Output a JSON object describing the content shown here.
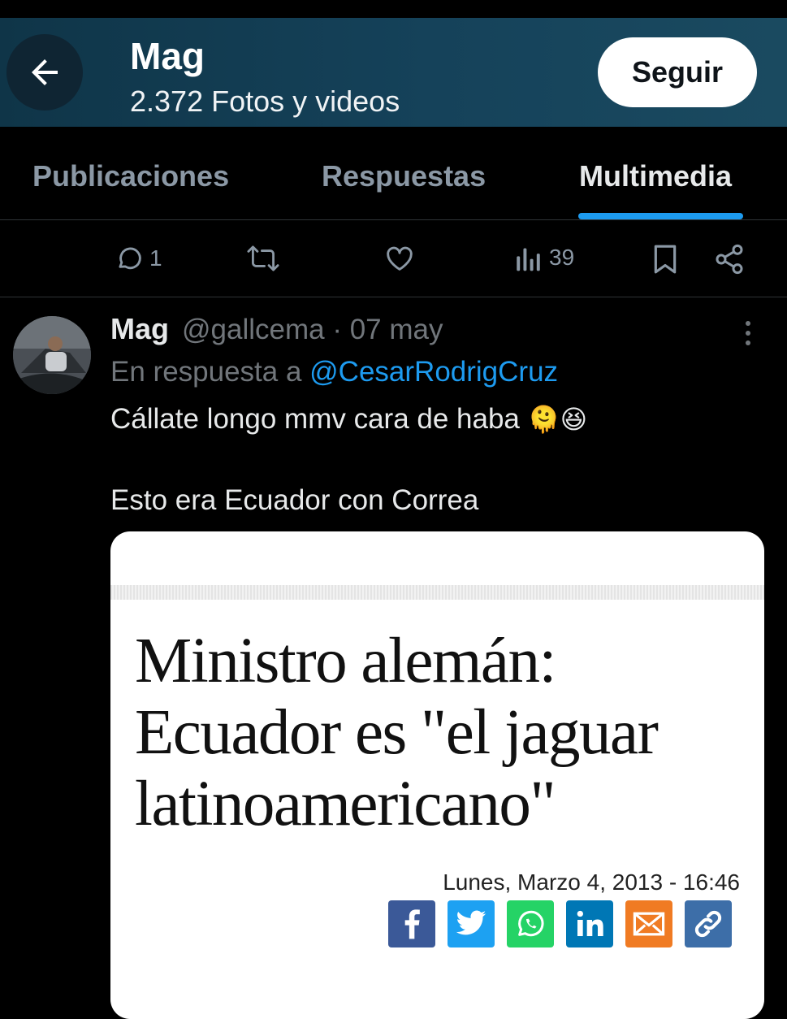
{
  "header": {
    "name": "Mag",
    "media_count": "2.372 Fotos y videos",
    "follow_label": "Seguir"
  },
  "tabs": [
    {
      "label": "Publicaciones",
      "active": false
    },
    {
      "label": "Respuestas",
      "active": false
    },
    {
      "label": "Multimedia",
      "active": true
    }
  ],
  "actions": {
    "reply_count": "1",
    "views_count": "39"
  },
  "tweet": {
    "author_name": "Mag",
    "author_handle": "@gallcema · 07 may",
    "reply_prefix": "En respuesta a ",
    "reply_to": "@CesarRodrigCruz",
    "text_line1": "Cállate longo mmv cara de haba",
    "emojis": "🫠😆",
    "text_line2": "Esto era Ecuador con Correa"
  },
  "media": {
    "headline_lines": [
      "Ministro alemán:",
      "Ecuador es \"el jaguar",
      "latinoamericano\""
    ],
    "dateline": "Lunes, Marzo 4, 2013 - 16:46",
    "share_buttons": [
      {
        "icon": "facebook-icon",
        "color": "#3b5998"
      },
      {
        "icon": "twitter-icon",
        "color": "#1da1f2"
      },
      {
        "icon": "whatsapp-icon",
        "color": "#25d366"
      },
      {
        "icon": "linkedin-icon",
        "color": "#0077b5"
      },
      {
        "icon": "email-icon",
        "color": "#f07b23"
      },
      {
        "icon": "link-icon",
        "color": "#3d6ea8"
      }
    ]
  },
  "colors": {
    "accent": "#1d9bf0",
    "background": "#000000",
    "secondary_text": "#71767b"
  }
}
